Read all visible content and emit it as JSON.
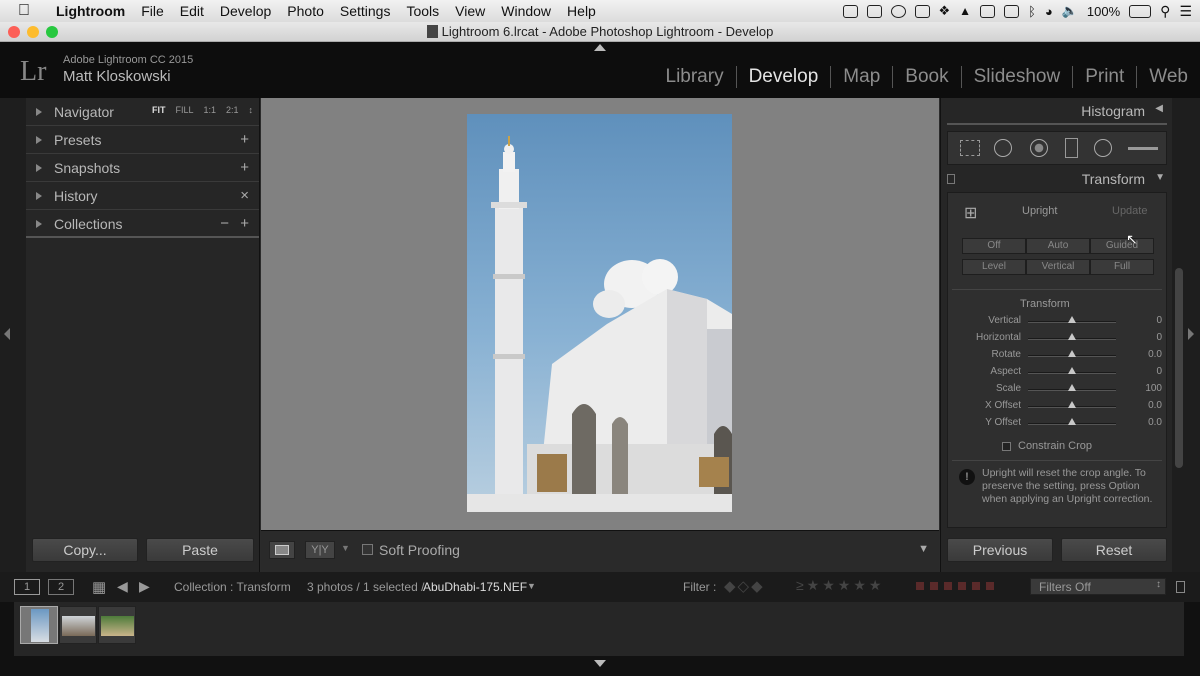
{
  "menubar": {
    "app": "Lightroom",
    "items": [
      "File",
      "Edit",
      "Develop",
      "Photo",
      "Settings",
      "Tools",
      "View",
      "Window",
      "Help"
    ],
    "battery": "100%"
  },
  "window": {
    "title": "Lightroom 6.lrcat - Adobe Photoshop Lightroom - Develop"
  },
  "identity": {
    "logo": "Lr",
    "version": "Adobe Lightroom CC 2015",
    "user": "Matt Kloskowski",
    "modules": [
      "Library",
      "Develop",
      "Map",
      "Book",
      "Slideshow",
      "Print",
      "Web"
    ],
    "active_module": "Develop"
  },
  "left_panel": {
    "navigator": {
      "label": "Navigator",
      "zoom": [
        "FIT",
        "FILL",
        "1:1",
        "2:1"
      ]
    },
    "presets": {
      "label": "Presets",
      "action": "+"
    },
    "snapshots": {
      "label": "Snapshots",
      "action": "+"
    },
    "history": {
      "label": "History",
      "action": "×"
    },
    "collections": {
      "label": "Collections",
      "action_minus": "−",
      "action_plus": "+"
    },
    "copy_button": "Copy...",
    "paste_button": "Paste"
  },
  "toolbar": {
    "soft_proofing": "Soft Proofing",
    "yy": "Y|Y"
  },
  "right_panel": {
    "histogram": "Histogram",
    "transform_header": "Transform",
    "upright": {
      "label": "Upright",
      "update": "Update"
    },
    "upright_buttons_row1": [
      "Off",
      "Auto",
      "Guided"
    ],
    "upright_buttons_row2": [
      "Level",
      "Vertical",
      "Full"
    ],
    "transform_section": "Transform",
    "sliders": [
      {
        "label": "Vertical",
        "value": "0",
        "position": 0.5
      },
      {
        "label": "Horizontal",
        "value": "0",
        "position": 0.5
      },
      {
        "label": "Rotate",
        "value": "0.0",
        "position": 0.5
      },
      {
        "label": "Aspect",
        "value": "0",
        "position": 0.5
      },
      {
        "label": "Scale",
        "value": "100",
        "position": 0.5
      },
      {
        "label": "X Offset",
        "value": "0.0",
        "position": 0.5
      },
      {
        "label": "Y Offset",
        "value": "0.0",
        "position": 0.5
      }
    ],
    "constrain_crop": "Constrain Crop",
    "info_text": "Upright will reset the crop angle. To preserve the setting, press Option when applying an Upright correction.",
    "previous_button": "Previous",
    "reset_button": "Reset"
  },
  "filmstrip_bar": {
    "screen1": "1",
    "screen2": "2",
    "collection": "Collection : Transform",
    "count": "3 photos / 1 selected /",
    "filename": "AbuDhabi-175.NEF",
    "filter_label": "Filter :",
    "filters_off": "Filters Off"
  },
  "filmstrip": {
    "thumbnail_count": 3,
    "selected_index": 0
  }
}
